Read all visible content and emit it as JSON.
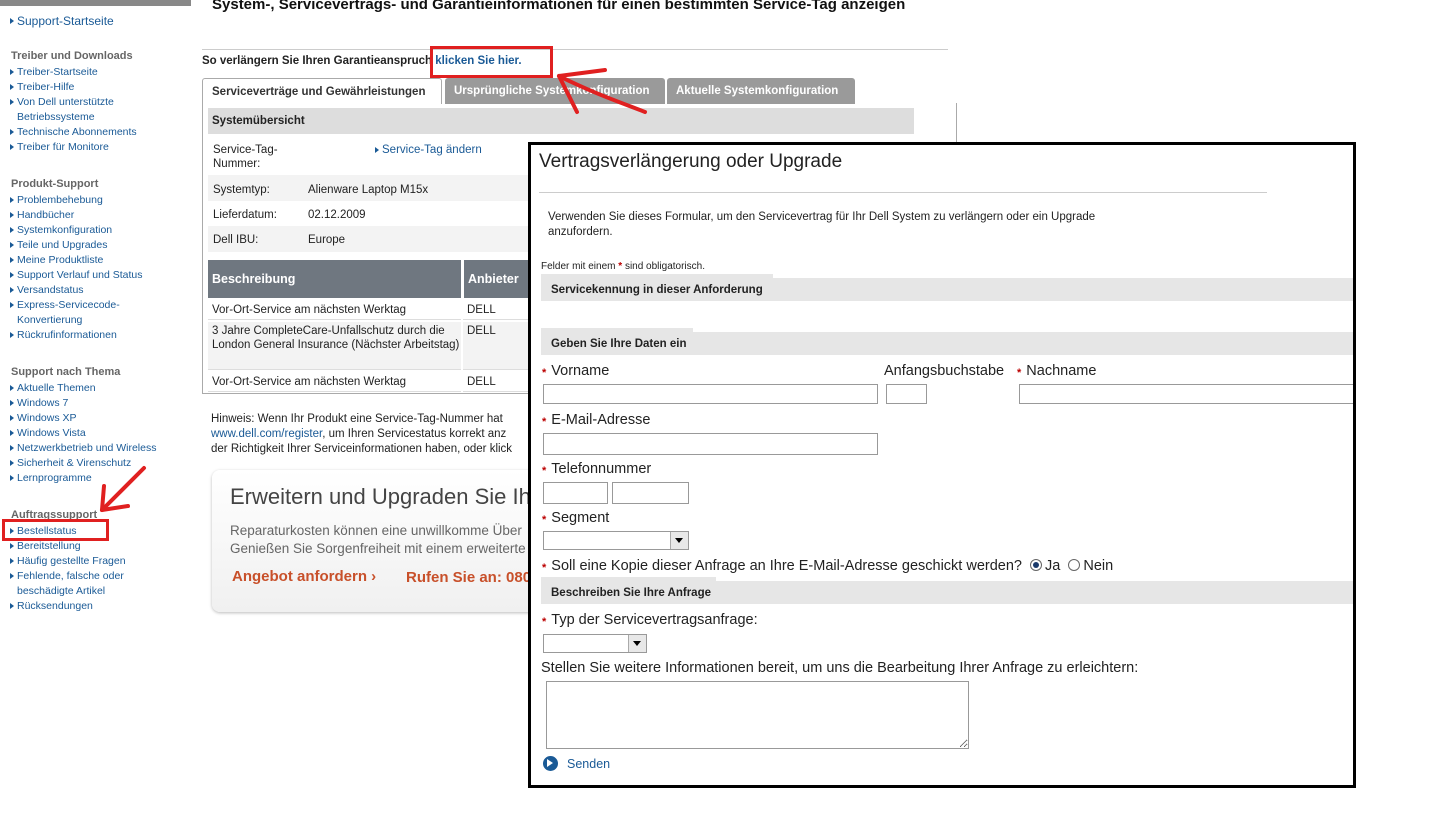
{
  "sidebar": {
    "home_link": "Support-Startseite",
    "sections": [
      {
        "title": "Treiber und Downloads",
        "items": [
          "Treiber-Startseite",
          "Treiber-Hilfe",
          "Von Dell unterstützte Betriebssysteme",
          "Technische Abonnements",
          "Treiber für Monitore"
        ]
      },
      {
        "title": "Produkt-Support",
        "items": [
          "Problembehebung",
          "Handbücher",
          "Systemkonfiguration",
          "Teile und Upgrades",
          "Meine Produktliste",
          "Support Verlauf und Status",
          "Versandstatus",
          "Express-Servicecode-Konvertierung",
          "Rückrufinformationen"
        ]
      },
      {
        "title": "Support nach Thema",
        "items": [
          "Aktuelle Themen",
          "Windows 7",
          "Windows XP",
          "Windows Vista",
          "Netzwerkbetrieb und Wireless",
          "Sicherheit & Virenschutz",
          "Lernprogramme"
        ]
      },
      {
        "title": "Auftragssupport",
        "items": [
          "Bestellstatus",
          "Bereitstellung",
          "Häufig gestellte Fragen",
          "Fehlende, falsche oder beschädigte Artikel",
          "Rücksendungen"
        ]
      }
    ]
  },
  "main": {
    "title": "System-, Servicevertrags- und Garantieinformationen für einen bestimmten Service-Tag anzeigen",
    "extend_text": "So verlängern Sie Ihren Garantieanspruch",
    "extend_link": "klicken Sie hier.",
    "tabs": [
      "Serviceverträge und Gewährleistungen",
      "Ursprüngliche Systemkonfiguration",
      "Aktuelle Systemkonfiguration"
    ],
    "system_overview": {
      "header": "Systemübersicht",
      "rows": [
        {
          "label": "Service-Tag-Nummer:",
          "value": ""
        },
        {
          "label": "Systemtyp:",
          "value": "Alienware Laptop M15x"
        },
        {
          "label": "Lieferdatum:",
          "value": "02.12.2009"
        },
        {
          "label": "Dell IBU:",
          "value": "Europe"
        }
      ],
      "change_link": "Service-Tag ändern"
    },
    "service_table": {
      "headers": [
        "Beschreibung",
        "Anbieter"
      ],
      "rows": [
        [
          "Vor-Ort-Service am nächsten Werktag",
          "DELL"
        ],
        [
          "3 Jahre CompleteCare-Unfallschutz durch die London General Insurance (Nächster Arbeitstag)",
          "DELL"
        ],
        [
          "Vor-Ort-Service am nächsten Werktag",
          "DELL"
        ]
      ]
    },
    "note": {
      "line1": "Hinweis: Wenn Ihr Produkt eine Service-Tag-Nummer hat",
      "link": "www.dell.com/register",
      "line2": ", um Ihren Servicestatus korrekt anz",
      "line3": "der Richtigkeit Ihrer Serviceinformationen haben, oder klick"
    },
    "promo": {
      "title": "Erweitern und Upgraden Sie Ih",
      "line1": "Reparaturkosten können eine unwillkomme Über",
      "line2": "Genießen Sie Sorgenfreiheit mit einem erweiterte",
      "cta": "Angebot anfordern ›",
      "call": "Rufen Sie an: 080"
    }
  },
  "dialog": {
    "title": "Vertragsverlängerung oder Upgrade",
    "intro": "Verwenden Sie dieses Formular, um den Servicevertrag für Ihr Dell System zu verlängern oder ein Upgrade anzufordern.",
    "required_note_prefix": "Felder mit einem",
    "required_note_suffix": "sind obligatorisch.",
    "sections": {
      "service_id": "Servicekennung in dieser Anforderung",
      "your_data": "Geben Sie Ihre Daten ein",
      "describe": "Beschreiben Sie Ihre Anfrage"
    },
    "fields": {
      "first_name": "Vorname",
      "initial": "Anfangsbuchstabe",
      "last_name": "Nachname",
      "email": "E-Mail-Adresse",
      "phone": "Telefonnummer",
      "segment": "Segment",
      "copy_question": "Soll eine Kopie dieser Anfrage an Ihre E-Mail-Adresse geschickt werden?",
      "yes": "Ja",
      "no": "Nein",
      "copy_selected": "Ja",
      "request_type": "Typ der Servicevertragsanfrage:",
      "more_info": "Stellen Sie weitere Informationen bereit, um uns die Bearbeitung Ihrer Anfrage zu erleichtern:"
    },
    "send": "Senden"
  },
  "colors": {
    "annotation": "#e02020",
    "link": "#1a5a96",
    "table_header": "#6f7780"
  }
}
